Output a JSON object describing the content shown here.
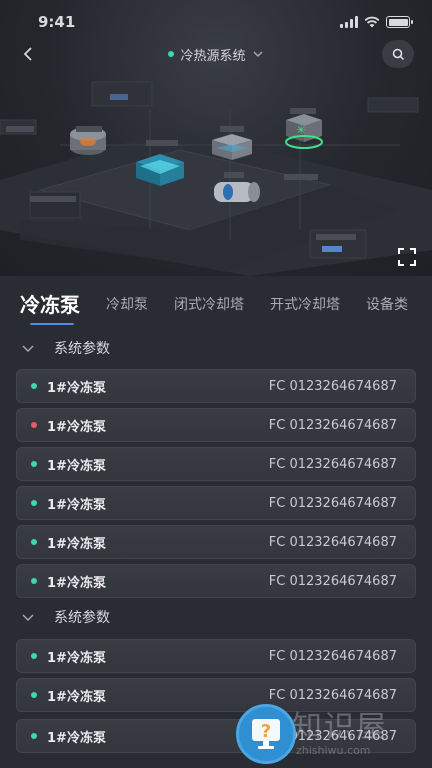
{
  "status_bar": {
    "time": "9:41"
  },
  "nav": {
    "title": "冷热源系统"
  },
  "tabs": [
    {
      "label": "冷冻泵",
      "active": true
    },
    {
      "label": "冷却泵",
      "active": false
    },
    {
      "label": "闭式冷却塔",
      "active": false
    },
    {
      "label": "开式冷却塔",
      "active": false
    },
    {
      "label": "设备类",
      "active": false
    }
  ],
  "sections": [
    {
      "title": "系统参数",
      "rows": [
        {
          "name": "1#冷冻泵",
          "code": "FC 0123264674687",
          "status": "normal"
        },
        {
          "name": "1#冷冻泵",
          "code": "FC 0123264674687",
          "status": "alarm"
        },
        {
          "name": "1#冷冻泵",
          "code": "FC 0123264674687",
          "status": "normal"
        },
        {
          "name": "1#冷冻泵",
          "code": "FC 0123264674687",
          "status": "normal"
        },
        {
          "name": "1#冷冻泵",
          "code": "FC 0123264674687",
          "status": "normal"
        },
        {
          "name": "1#冷冻泵",
          "code": "FC 0123264674687",
          "status": "normal"
        }
      ]
    },
    {
      "title": "系统参数",
      "rows": [
        {
          "name": "1#冷冻泵",
          "code": "FC 0123264674687",
          "status": "normal"
        },
        {
          "name": "1#冷冻泵",
          "code": "FC 0123264674687",
          "status": "normal"
        },
        {
          "name": "1#冷冻泵",
          "code": "FC 0123264674687",
          "status": "normal"
        }
      ]
    }
  ],
  "colors": {
    "normal": "#3fd6b0",
    "alarm": "#f0566e",
    "accent": "#4f8be0"
  },
  "help_badge": {
    "icon": "question-monitor-icon",
    "label": "?"
  },
  "watermark": {
    "big": "知识屋",
    "small": "zhishiwu.com"
  }
}
